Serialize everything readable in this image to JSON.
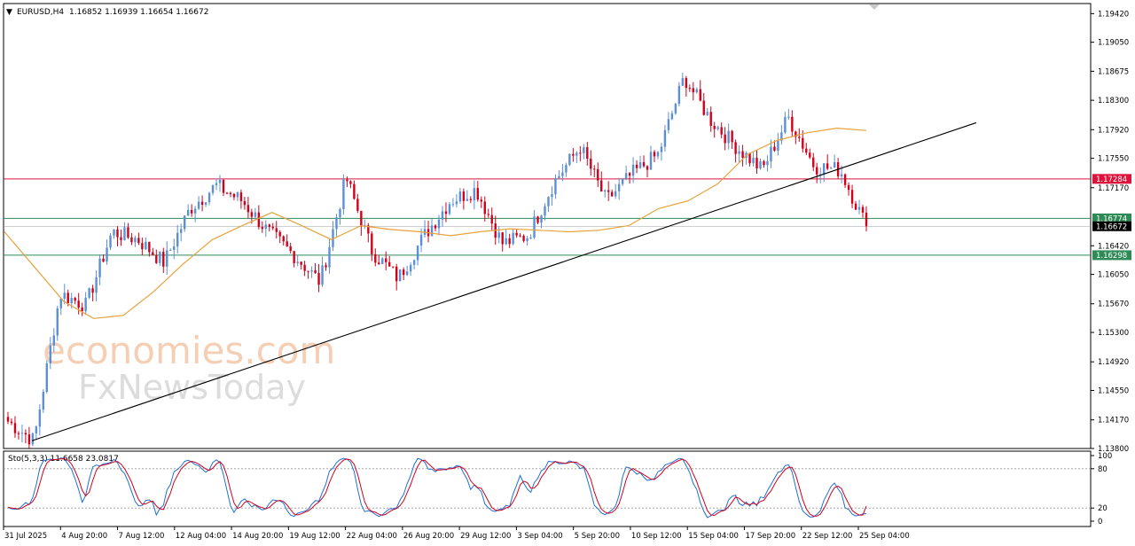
{
  "header": {
    "symbol": "EURUSD,H4",
    "ohlc": "1.16852 1.16939 1.16654 1.16672"
  },
  "oscillator": {
    "title": "Sto(5,3,3) 11.6658 23.0817"
  },
  "watermark": {
    "line1": "economies.com",
    "line2": "FxNewsToday"
  },
  "price_axis": {
    "ticks": [
      "1.19420",
      "1.19050",
      "1.18675",
      "1.18300",
      "1.17920",
      "1.17550",
      "1.17170",
      "1.16420",
      "1.16050",
      "1.15670",
      "1.15300",
      "1.14920",
      "1.14550",
      "1.14170",
      "1.13800"
    ]
  },
  "stoch_axis": {
    "ticks": [
      "100",
      "80",
      "20",
      "0"
    ]
  },
  "time_axis": {
    "labels": [
      "31 Jul 2025",
      "4 Aug 20:00",
      "7 Aug 12:00",
      "12 Aug 04:00",
      "14 Aug 20:00",
      "19 Aug 12:00",
      "22 Aug 04:00",
      "26 Aug 20:00",
      "29 Aug 12:00",
      "3 Sep 04:00",
      "5 Sep 20:00",
      "10 Sep 12:00",
      "15 Sep 04:00",
      "17 Sep 20:00",
      "22 Sep 12:00",
      "25 Sep 04:00"
    ]
  },
  "levels": [
    {
      "label": "1.17284",
      "value": 1.17284,
      "color": "#dc143c",
      "kind": "resistance"
    },
    {
      "label": "1.16774",
      "value": 1.16774,
      "color": "#2e8b57",
      "kind": "support"
    },
    {
      "label": "1.16672",
      "value": 1.16672,
      "color": "#000000",
      "kind": "current"
    },
    {
      "label": "1.16298",
      "value": 1.16298,
      "color": "#2e8b57",
      "kind": "support"
    }
  ],
  "colors": {
    "bull": "#5b8fd6",
    "bear": "#d0021b",
    "ma": "#e8a23a",
    "trendline": "#000000",
    "stoch_main": "#1e6fd9",
    "stoch_signal": "#d0021b"
  },
  "chart_data": {
    "type": "candlestick",
    "symbol": "EURUSD",
    "timeframe": "H4",
    "ylim": [
      1.138,
      1.1955
    ],
    "close_path": [
      {
        "time": "31 Jul 2025",
        "close": 1.1415
      },
      {
        "time": "1 Aug 2025",
        "close": 1.139
      },
      {
        "time": "1 Aug 2025 pm",
        "close": 1.158
      },
      {
        "time": "4 Aug 20:00",
        "close": 1.1565
      },
      {
        "time": "6 Aug",
        "close": 1.166
      },
      {
        "time": "7 Aug 12:00",
        "close": 1.165
      },
      {
        "time": "11 Aug",
        "close": 1.162
      },
      {
        "time": "12 Aug 04:00",
        "close": 1.169
      },
      {
        "time": "13 Aug",
        "close": 1.172
      },
      {
        "time": "14 Aug 20:00",
        "close": 1.17
      },
      {
        "time": "15 Aug",
        "close": 1.166
      },
      {
        "time": "19 Aug 12:00",
        "close": 1.163
      },
      {
        "time": "21 Aug",
        "close": 1.1595
      },
      {
        "time": "22 Aug 04:00",
        "close": 1.173
      },
      {
        "time": "25 Aug",
        "close": 1.1635
      },
      {
        "time": "26 Aug 20:00",
        "close": 1.16
      },
      {
        "time": "27 Aug",
        "close": 1.1655
      },
      {
        "time": "29 Aug 12:00",
        "close": 1.17
      },
      {
        "time": "1 Sep",
        "close": 1.1715
      },
      {
        "time": "3 Sep 04:00",
        "close": 1.1645
      },
      {
        "time": "4 Sep",
        "close": 1.1655
      },
      {
        "time": "5 Sep 20:00",
        "close": 1.1725
      },
      {
        "time": "8 Sep",
        "close": 1.177
      },
      {
        "time": "10 Sep 12:00",
        "close": 1.17
      },
      {
        "time": "11 Sep",
        "close": 1.1735
      },
      {
        "time": "15 Sep 04:00",
        "close": 1.176
      },
      {
        "time": "16 Sep",
        "close": 1.186
      },
      {
        "time": "17 Sep 20:00",
        "close": 1.1805
      },
      {
        "time": "18 Sep",
        "close": 1.177
      },
      {
        "time": "22 Sep 12:00",
        "close": 1.174
      },
      {
        "time": "23 Sep",
        "close": 1.1808
      },
      {
        "time": "24 Sep",
        "close": 1.1745
      },
      {
        "time": "25 Sep 04:00",
        "close": 1.174
      },
      {
        "time": "25 Sep",
        "close": 1.16672
      }
    ],
    "trendline": {
      "from": {
        "time": "31 Jul 2025",
        "value": 1.139
      },
      "to": {
        "time": "25 Sep",
        "value": 1.1801
      }
    },
    "moving_average": [
      1.166,
      1.1615,
      1.157,
      1.1548,
      1.1552,
      1.1582,
      1.1618,
      1.165,
      1.1668,
      1.1685,
      1.1668,
      1.165,
      1.1668,
      1.1663,
      1.166,
      1.1655,
      1.166,
      1.1664,
      1.1662,
      1.166,
      1.1662,
      1.1668,
      1.169,
      1.17,
      1.1722,
      1.176,
      1.1778,
      1.1788,
      1.1794,
      1.1791
    ],
    "stochastic": {
      "params": "5,3,3",
      "main": 11.6658,
      "signal": 23.0817,
      "levels": [
        80,
        20
      ]
    }
  }
}
